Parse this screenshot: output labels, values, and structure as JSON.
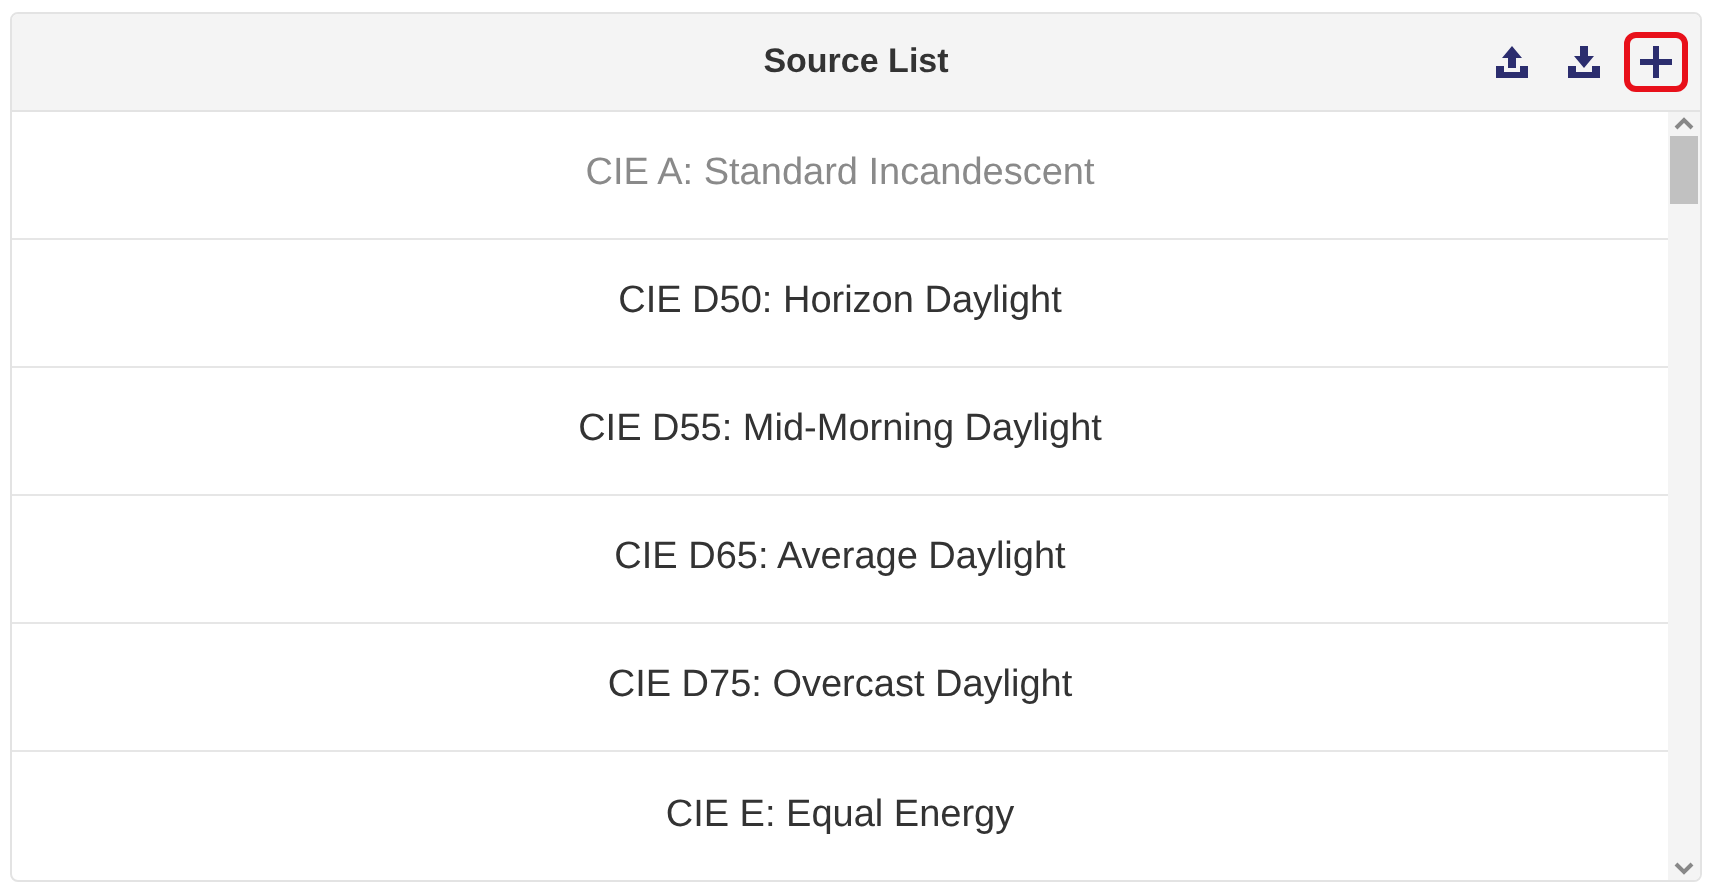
{
  "header": {
    "title": "Source List",
    "actions": [
      {
        "kind": "upload",
        "highlighted": false
      },
      {
        "kind": "download",
        "highlighted": false
      },
      {
        "kind": "add",
        "highlighted": true
      }
    ]
  },
  "sources": [
    {
      "label": "CIE A: Standard Incandescent",
      "dimmed": true
    },
    {
      "label": "CIE D50: Horizon Daylight",
      "dimmed": false
    },
    {
      "label": "CIE D55: Mid-Morning Daylight",
      "dimmed": false
    },
    {
      "label": "CIE D65: Average Daylight",
      "dimmed": false
    },
    {
      "label": "CIE D75: Overcast Daylight",
      "dimmed": false
    },
    {
      "label": "CIE E: Equal Energy",
      "dimmed": false
    }
  ]
}
